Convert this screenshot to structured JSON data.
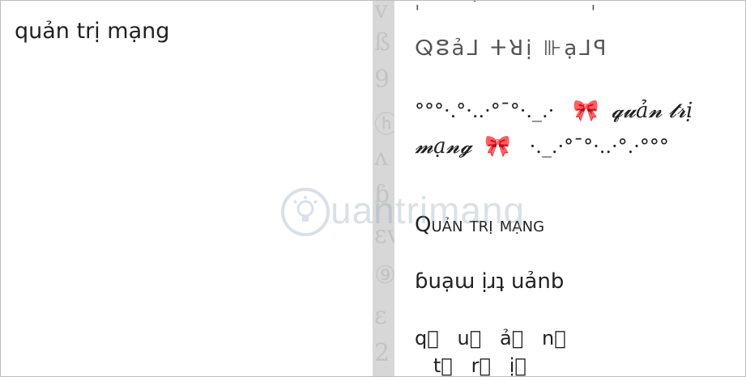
{
  "input": {
    "text": "quản trị mạng"
  },
  "divider": {
    "ghost_glyphs": [
      "v",
      "ß",
      "9",
      "ⓗ",
      "ʌ",
      "ɓ",
      "ɛv",
      "⑨",
      "ɛ",
      "2"
    ]
  },
  "output": {
    "top_partial": "ˌ · ˙ ˌ",
    "magic": "ⵕⵓả⅃ ⵜꓤị ⊪ạ⅃ꟼ",
    "kaomoji": {
      "prefix": "°°°·.°·..·°¯°·._.·",
      "bow_left": "🎀",
      "italic_text_1": "𝓺𝓾ả𝓷",
      "italic_text_2": "𝓽𝓻ị 𝓶ạ𝓷𝓰",
      "bow_right": "🎀",
      "suffix": "·._.·°¯°·..·°.·°°°"
    },
    "small_caps": {
      "q": "Q",
      "rest": "uản trị mạng"
    },
    "flipped": "ɓuạɯ ịɹʇ uảnb",
    "boxed_line_1": "q⃞   u⃞   ả⃞   n⃞",
    "boxed_line_2": "   t⃞   r⃞   ị⃞"
  },
  "watermark": {
    "text": "uantrimang",
    "icon": "lightbulb-logo-icon"
  }
}
